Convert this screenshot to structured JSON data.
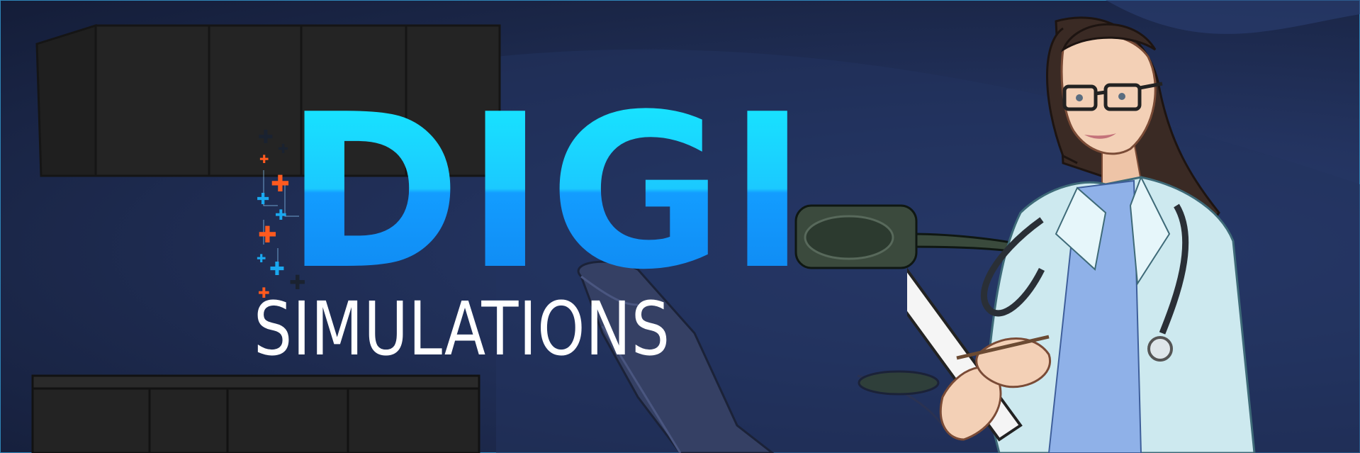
{
  "banner": {
    "logo": {
      "main_word": "DIGI",
      "sub_word": "SIMULATIONS",
      "main_gradient": [
        "#17e9ff",
        "#0f86f0"
      ],
      "plus_colors": [
        "#1aa9f0",
        "#ff5a1f",
        "#1a2230"
      ]
    },
    "background_color": "#1c2749",
    "illustration": "doctor-with-clipboard",
    "scene": "clinic-room-with-dental-chair"
  }
}
